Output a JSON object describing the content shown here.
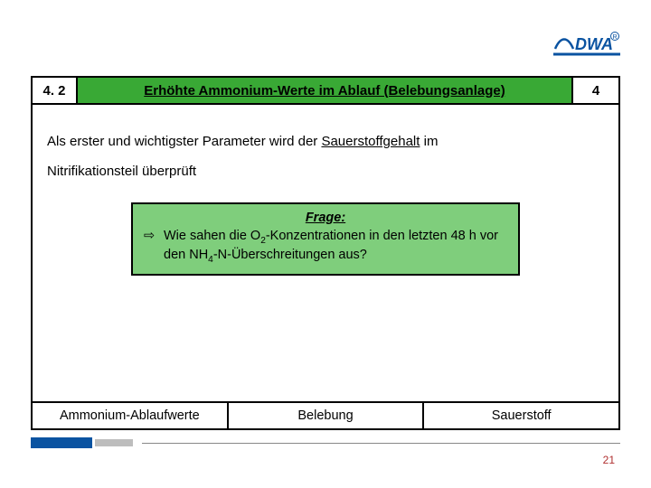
{
  "logo": {
    "text": "DWA"
  },
  "header": {
    "section_number": "4. 2",
    "title": "Erhöhte Ammonium-Werte im Ablauf (Belebungsanlage)",
    "page_in_section": "4"
  },
  "body": {
    "line1_a": "Als erster und wichtigster Parameter wird der ",
    "line1_b": "Sauerstoffgehalt",
    "line1_c": "  im",
    "line2": "Nitrifikationsteil überprüft"
  },
  "question": {
    "heading": "Frage:",
    "arrow": "⇨",
    "text_a": "Wie sahen die O",
    "sub1": "2",
    "text_b": "-Konzentrationen in den letzten 48 h vor den NH",
    "sub2": "4",
    "text_c": "-N-Überschreitungen aus?"
  },
  "footer": {
    "cell1": "Ammonium-Ablaufwerte",
    "cell2": "Belebung",
    "cell3": "Sauerstoff"
  },
  "slide_number": "21"
}
